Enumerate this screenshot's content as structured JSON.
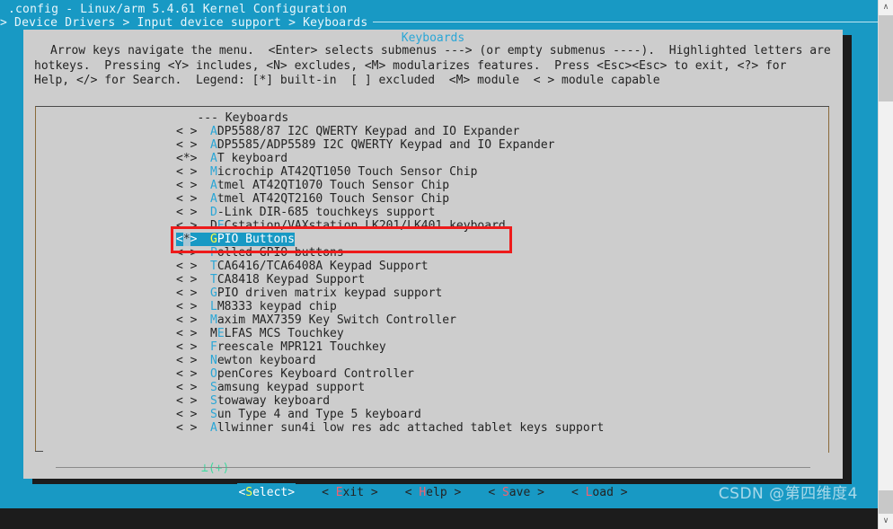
{
  "terminal": {
    "title": ".config - Linux/arm 5.4.61 Kernel Configuration",
    "breadcrumb": "> Device Drivers > Input device support > Keyboards"
  },
  "dialog": {
    "title": "Keyboards",
    "help_lines": [
      "Arrow keys navigate the menu.  <Enter> selects submenus ---> (or empty submenus ----).  Highlighted letters are",
      "hotkeys.  Pressing <Y> includes, <N> excludes, <M> modularizes features.  Press <Esc><Esc> to exit, <?> for",
      "Help, </> for Search.  Legend: [*] built-in  [ ] excluded  <M> module  < > module capable"
    ],
    "scroll_indicator": "⊥(+)"
  },
  "menu": {
    "header": "--- Keyboards",
    "items": [
      {
        "flag": "< >",
        "hot": "A",
        "rest": "DP5588/87 I2C QWERTY Keypad and IO Expander",
        "selected": false
      },
      {
        "flag": "< >",
        "hot": "A",
        "rest": "DP5585/ADP5589 I2C QWERTY Keypad and IO Expander",
        "selected": false
      },
      {
        "flag": "<*>",
        "hot": "A",
        "rest": "T keyboard",
        "selected": false
      },
      {
        "flag": "< >",
        "hot": "M",
        "rest": "icrochip AT42QT1050 Touch Sensor Chip",
        "selected": false,
        "hot_index": 1
      },
      {
        "flag": "< >",
        "hot": "A",
        "rest": "tmel AT42QT1070 Touch Sensor Chip",
        "selected": false
      },
      {
        "flag": "< >",
        "hot": "A",
        "rest": "tmel AT42QT2160 Touch Sensor Chip",
        "selected": false
      },
      {
        "flag": "< >",
        "hot": "D",
        "rest": "-Link DIR-685 touchkeys support",
        "selected": false
      },
      {
        "flag": "< >",
        "hot": "E",
        "rest": "Cstation/VAXstation LK201/LK401 keyboard",
        "selected": false,
        "prefix": "D"
      },
      {
        "flag": "<*>",
        "hot": "G",
        "rest": "PIO Buttons",
        "selected": true
      },
      {
        "flag": "< >",
        "hot": "P",
        "rest": "olled GPIO buttons",
        "selected": false
      },
      {
        "flag": "< >",
        "hot": "T",
        "rest": "CA6416/TCA6408A Keypad Support",
        "selected": false
      },
      {
        "flag": "< >",
        "hot": "T",
        "rest": "CA8418 Keypad Support",
        "selected": false
      },
      {
        "flag": "< >",
        "hot": "G",
        "rest": "PIO driven matrix keypad support",
        "selected": false
      },
      {
        "flag": "< >",
        "hot": "L",
        "rest": "M8333 keypad chip",
        "selected": false
      },
      {
        "flag": "< >",
        "hot": "M",
        "rest": "axim MAX7359 Key Switch Controller",
        "selected": false
      },
      {
        "flag": "< >",
        "hot": "E",
        "rest": "LFAS MCS Touchkey",
        "selected": false,
        "prefix": "M"
      },
      {
        "flag": "< >",
        "hot": "F",
        "rest": "reescale MPR121 Touchkey",
        "selected": false
      },
      {
        "flag": "< >",
        "hot": "N",
        "rest": "ewton keyboard",
        "selected": false
      },
      {
        "flag": "< >",
        "hot": "O",
        "rest": "penCores Keyboard Controller",
        "selected": false
      },
      {
        "flag": "< >",
        "hot": "S",
        "rest": "amsung keypad support",
        "selected": false
      },
      {
        "flag": "< >",
        "hot": "S",
        "rest": "towaway keyboard",
        "selected": false
      },
      {
        "flag": "< >",
        "hot": "S",
        "rest": "un Type 4 and Type 5 keyboard",
        "selected": false
      },
      {
        "flag": "< >",
        "hot": "A",
        "rest": "llwinner sun4i low res adc attached tablet keys support",
        "selected": false
      }
    ]
  },
  "buttons": [
    {
      "pre": "<",
      "hot": "S",
      "post": "elect>",
      "selected": true
    },
    {
      "pre": "< ",
      "hot": "E",
      "post": "xit >",
      "selected": false
    },
    {
      "pre": "< ",
      "hot": "H",
      "post": "elp >",
      "selected": false
    },
    {
      "pre": "< ",
      "hot": "S",
      "post": "ave >",
      "selected": false
    },
    {
      "pre": "< ",
      "hot": "L",
      "post": "oad >",
      "selected": false
    }
  ],
  "watermark": "CSDN @第四维度4",
  "scrollbar": {
    "up_arrow": "∧",
    "down_arrow": "∨"
  },
  "colors": {
    "terminal_bg": "#1899c4",
    "dialog_bg": "#cdcdcd",
    "hotkey": "#2aa6d6",
    "selected_bg": "#1899c4",
    "selected_hotkey": "#ffff44",
    "button_hotkey": "#f4606f",
    "annotation": "#ee1b1b",
    "scroll_indicator": "#3ddba0"
  }
}
